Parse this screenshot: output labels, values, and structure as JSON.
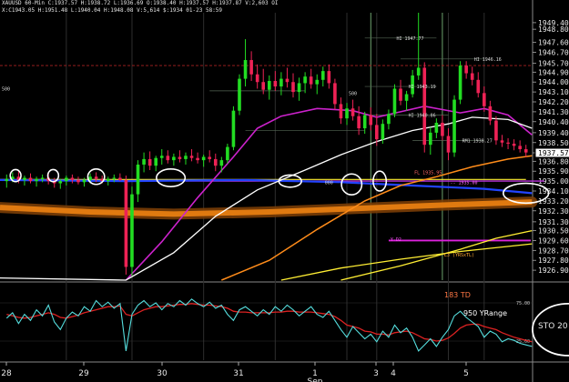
{
  "header": {
    "line1": "XAUUSD 60-Min  C:1937.57  H:1938.72  L:1936.69  O:1938.40  H:1937.57  H:1937.87  V:2,603  OI",
    "line2": "X:C1943.05  H:1951.48  L:1940.04  H:1948.08  V:5,614  $:1934  01-23  58:59"
  },
  "colors": {
    "up": "#22dd22",
    "down": "#ee2255",
    "bg": "#000000",
    "ma_fast": "#ffffff",
    "ma_mid": "#cc22cc",
    "ma_orange": "#ff8c1a",
    "ma_blue": "#2244ff",
    "ma_yellow": "#ffee33",
    "band_orange": "#e07a10",
    "osc_cyan": "#55dddd",
    "osc_red": "#dd2222",
    "ellipse": "#ffffff",
    "price_box": "#ffffff"
  },
  "chart_data": {
    "type": "candlestick",
    "ylim": [
      1926.0,
      1950.3
    ],
    "y_ticks": [
      "1949.40",
      "1948.80",
      "1947.60",
      "1946.70",
      "1945.70",
      "1944.90",
      "1944.00",
      "1943.10",
      "1942.20",
      "1941.30",
      "1940.40",
      "1939.40",
      "1938.50",
      "1937.57",
      "1936.80",
      "1935.90",
      "1935.00",
      "1934.10",
      "1933.20",
      "1932.30",
      "1931.30",
      "1930.50",
      "1929.60",
      "1928.70",
      "1927.80",
      "1926.90"
    ],
    "current_price": "1937.57",
    "x_ticks": [
      "28",
      "29",
      "30",
      "31",
      "1",
      "3",
      "4",
      "5"
    ],
    "x_sub_label": "Sep",
    "candles": [
      {
        "o": 1935.0,
        "h": 1935.6,
        "l": 1934.4,
        "c": 1935.2
      },
      {
        "o": 1935.2,
        "h": 1935.8,
        "l": 1934.9,
        "c": 1935.4
      },
      {
        "o": 1935.4,
        "h": 1935.9,
        "l": 1934.8,
        "c": 1935.1
      },
      {
        "o": 1935.1,
        "h": 1935.5,
        "l": 1934.6,
        "c": 1935.3
      },
      {
        "o": 1935.3,
        "h": 1935.7,
        "l": 1934.8,
        "c": 1935.0
      },
      {
        "o": 1935.0,
        "h": 1935.4,
        "l": 1934.5,
        "c": 1935.2
      },
      {
        "o": 1935.2,
        "h": 1935.6,
        "l": 1934.9,
        "c": 1935.3
      },
      {
        "o": 1935.3,
        "h": 1935.8,
        "l": 1934.7,
        "c": 1935.0
      },
      {
        "o": 1935.0,
        "h": 1935.3,
        "l": 1934.4,
        "c": 1934.8
      },
      {
        "o": 1934.8,
        "h": 1935.2,
        "l": 1934.3,
        "c": 1935.0
      },
      {
        "o": 1935.0,
        "h": 1935.5,
        "l": 1934.6,
        "c": 1935.3
      },
      {
        "o": 1935.3,
        "h": 1935.6,
        "l": 1934.8,
        "c": 1935.1
      },
      {
        "o": 1935.1,
        "h": 1935.4,
        "l": 1934.7,
        "c": 1934.9
      },
      {
        "o": 1934.9,
        "h": 1935.3,
        "l": 1934.5,
        "c": 1935.1
      },
      {
        "o": 1935.1,
        "h": 1935.7,
        "l": 1934.8,
        "c": 1935.4
      },
      {
        "o": 1935.4,
        "h": 1935.8,
        "l": 1934.9,
        "c": 1935.2
      },
      {
        "o": 1935.2,
        "h": 1935.5,
        "l": 1934.8,
        "c": 1935.0
      },
      {
        "o": 1935.0,
        "h": 1935.4,
        "l": 1934.6,
        "c": 1935.2
      },
      {
        "o": 1935.2,
        "h": 1935.6,
        "l": 1934.9,
        "c": 1935.3
      },
      {
        "o": 1935.3,
        "h": 1935.7,
        "l": 1935.0,
        "c": 1935.1
      },
      {
        "o": 1935.1,
        "h": 1935.5,
        "l": 1926.5,
        "c": 1927.2
      },
      {
        "o": 1927.2,
        "h": 1934.5,
        "l": 1926.4,
        "c": 1933.8
      },
      {
        "o": 1933.8,
        "h": 1936.9,
        "l": 1933.1,
        "c": 1936.5
      },
      {
        "o": 1936.5,
        "h": 1937.6,
        "l": 1935.8,
        "c": 1937.0
      },
      {
        "o": 1937.0,
        "h": 1937.7,
        "l": 1936.0,
        "c": 1936.4
      },
      {
        "o": 1936.4,
        "h": 1937.3,
        "l": 1935.9,
        "c": 1937.1
      },
      {
        "o": 1937.1,
        "h": 1937.9,
        "l": 1936.5,
        "c": 1937.3
      },
      {
        "o": 1937.3,
        "h": 1937.8,
        "l": 1936.6,
        "c": 1936.9
      },
      {
        "o": 1936.9,
        "h": 1937.5,
        "l": 1936.4,
        "c": 1937.2
      },
      {
        "o": 1937.2,
        "h": 1937.8,
        "l": 1936.7,
        "c": 1937.0
      },
      {
        "o": 1937.0,
        "h": 1937.6,
        "l": 1936.5,
        "c": 1937.3
      },
      {
        "o": 1937.3,
        "h": 1937.9,
        "l": 1936.8,
        "c": 1937.1
      },
      {
        "o": 1937.1,
        "h": 1937.6,
        "l": 1936.6,
        "c": 1936.9
      },
      {
        "o": 1936.9,
        "h": 1937.4,
        "l": 1936.3,
        "c": 1937.2
      },
      {
        "o": 1937.2,
        "h": 1937.8,
        "l": 1936.7,
        "c": 1937.0
      },
      {
        "o": 1937.0,
        "h": 1937.5,
        "l": 1935.9,
        "c": 1936.4
      },
      {
        "o": 1936.4,
        "h": 1937.2,
        "l": 1935.8,
        "c": 1936.9
      },
      {
        "o": 1936.9,
        "h": 1938.4,
        "l": 1936.6,
        "c": 1938.1
      },
      {
        "o": 1938.1,
        "h": 1941.8,
        "l": 1937.8,
        "c": 1941.4
      },
      {
        "o": 1941.4,
        "h": 1944.7,
        "l": 1941.0,
        "c": 1944.3
      },
      {
        "o": 1944.3,
        "h": 1947.9,
        "l": 1943.6,
        "c": 1946.0
      },
      {
        "o": 1946.0,
        "h": 1946.8,
        "l": 1944.1,
        "c": 1944.7
      },
      {
        "o": 1944.7,
        "h": 1945.6,
        "l": 1943.4,
        "c": 1944.0
      },
      {
        "o": 1944.0,
        "h": 1945.2,
        "l": 1942.9,
        "c": 1943.3
      },
      {
        "o": 1943.3,
        "h": 1944.6,
        "l": 1942.4,
        "c": 1944.1
      },
      {
        "o": 1944.1,
        "h": 1945.0,
        "l": 1943.2,
        "c": 1943.6
      },
      {
        "o": 1943.6,
        "h": 1944.9,
        "l": 1942.8,
        "c": 1944.3
      },
      {
        "o": 1944.3,
        "h": 1945.3,
        "l": 1943.5,
        "c": 1944.0
      },
      {
        "o": 1944.0,
        "h": 1944.8,
        "l": 1942.6,
        "c": 1943.1
      },
      {
        "o": 1943.1,
        "h": 1944.4,
        "l": 1942.3,
        "c": 1943.9
      },
      {
        "o": 1943.9,
        "h": 1944.9,
        "l": 1943.0,
        "c": 1944.5
      },
      {
        "o": 1944.5,
        "h": 1945.2,
        "l": 1943.4,
        "c": 1943.8
      },
      {
        "o": 1943.8,
        "h": 1944.7,
        "l": 1942.9,
        "c": 1944.2
      },
      {
        "o": 1944.2,
        "h": 1945.4,
        "l": 1943.6,
        "c": 1945.0
      },
      {
        "o": 1945.0,
        "h": 1945.6,
        "l": 1943.4,
        "c": 1943.9
      },
      {
        "o": 1943.9,
        "h": 1944.3,
        "l": 1941.5,
        "c": 1942.0
      },
      {
        "o": 1942.0,
        "h": 1942.6,
        "l": 1940.2,
        "c": 1940.7
      },
      {
        "o": 1940.7,
        "h": 1942.1,
        "l": 1940.1,
        "c": 1941.6
      },
      {
        "o": 1941.6,
        "h": 1942.4,
        "l": 1940.5,
        "c": 1940.9
      },
      {
        "o": 1940.9,
        "h": 1941.8,
        "l": 1939.2,
        "c": 1939.8
      },
      {
        "o": 1939.8,
        "h": 1941.3,
        "l": 1939.3,
        "c": 1941.0
      },
      {
        "o": 1941.0,
        "h": 1941.7,
        "l": 1939.6,
        "c": 1940.1
      },
      {
        "o": 1940.1,
        "h": 1941.1,
        "l": 1938.2,
        "c": 1938.8
      },
      {
        "o": 1938.8,
        "h": 1940.6,
        "l": 1938.4,
        "c": 1940.2
      },
      {
        "o": 1940.2,
        "h": 1941.5,
        "l": 1939.7,
        "c": 1941.1
      },
      {
        "o": 1941.1,
        "h": 1943.8,
        "l": 1940.8,
        "c": 1943.4
      },
      {
        "o": 1943.4,
        "h": 1944.2,
        "l": 1941.9,
        "c": 1942.3
      },
      {
        "o": 1942.3,
        "h": 1943.2,
        "l": 1941.4,
        "c": 1942.9
      },
      {
        "o": 1942.9,
        "h": 1945.1,
        "l": 1942.6,
        "c": 1944.6
      },
      {
        "o": 1944.6,
        "h": 1950.3,
        "l": 1944.2,
        "c": 1945.3
      },
      {
        "o": 1945.3,
        "h": 1945.8,
        "l": 1937.6,
        "c": 1938.3
      },
      {
        "o": 1938.3,
        "h": 1939.9,
        "l": 1937.4,
        "c": 1939.4
      },
      {
        "o": 1939.4,
        "h": 1940.7,
        "l": 1938.9,
        "c": 1940.3
      },
      {
        "o": 1940.3,
        "h": 1941.0,
        "l": 1938.7,
        "c": 1939.1
      },
      {
        "o": 1939.1,
        "h": 1939.8,
        "l": 1936.9,
        "c": 1937.6
      },
      {
        "o": 1937.6,
        "h": 1942.8,
        "l": 1937.2,
        "c": 1942.4
      },
      {
        "o": 1942.4,
        "h": 1945.9,
        "l": 1942.0,
        "c": 1945.5
      },
      {
        "o": 1945.5,
        "h": 1945.9,
        "l": 1944.3,
        "c": 1944.8
      },
      {
        "o": 1944.8,
        "h": 1945.4,
        "l": 1943.7,
        "c": 1944.2
      },
      {
        "o": 1944.2,
        "h": 1944.9,
        "l": 1942.6,
        "c": 1943.0
      },
      {
        "o": 1943.0,
        "h": 1943.6,
        "l": 1941.3,
        "c": 1941.8
      },
      {
        "o": 1941.8,
        "h": 1942.3,
        "l": 1940.1,
        "c": 1940.5
      },
      {
        "o": 1940.5,
        "h": 1940.9,
        "l": 1938.3,
        "c": 1938.7
      },
      {
        "o": 1938.7,
        "h": 1939.2,
        "l": 1938.1,
        "c": 1938.5
      },
      {
        "o": 1938.5,
        "h": 1938.9,
        "l": 1937.9,
        "c": 1938.4
      },
      {
        "o": 1938.4,
        "h": 1938.8,
        "l": 1937.8,
        "c": 1938.2
      },
      {
        "o": 1938.2,
        "h": 1938.7,
        "l": 1937.6,
        "c": 1937.9
      },
      {
        "o": 1937.9,
        "h": 1938.3,
        "l": 1937.2,
        "c": 1937.6
      }
    ],
    "ma_white": [
      [
        0,
        1926.2
      ],
      [
        20,
        1926.0
      ],
      [
        28,
        1928.5
      ],
      [
        35,
        1931.8
      ],
      [
        42,
        1934.2
      ],
      [
        50,
        1936.0
      ],
      [
        56,
        1937.4
      ],
      [
        62,
        1938.6
      ],
      [
        68,
        1939.6
      ],
      [
        74,
        1940.2
      ],
      [
        78,
        1940.8
      ],
      [
        84,
        1940.6
      ],
      [
        88,
        1939.8
      ]
    ],
    "ma_magenta": [
      [
        20,
        1926.0
      ],
      [
        26,
        1929.5
      ],
      [
        32,
        1933.5
      ],
      [
        38,
        1937.2
      ],
      [
        42,
        1939.8
      ],
      [
        46,
        1940.9
      ],
      [
        52,
        1941.6
      ],
      [
        58,
        1941.4
      ],
      [
        62,
        1940.8
      ],
      [
        66,
        1941.3
      ],
      [
        70,
        1941.8
      ],
      [
        76,
        1941.2
      ],
      [
        80,
        1941.6
      ],
      [
        84,
        1941.0
      ],
      [
        88,
        1939.2
      ]
    ],
    "ma_orange": [
      [
        36,
        1926.0
      ],
      [
        44,
        1927.8
      ],
      [
        52,
        1930.6
      ],
      [
        60,
        1933.2
      ],
      [
        66,
        1934.6
      ],
      [
        72,
        1935.4
      ],
      [
        78,
        1936.3
      ],
      [
        84,
        1937.0
      ],
      [
        88,
        1937.3
      ]
    ],
    "ma_blue": [
      [
        0,
        1935.1
      ],
      [
        20,
        1935.0
      ],
      [
        40,
        1935.1
      ],
      [
        56,
        1934.9
      ],
      [
        68,
        1934.6
      ],
      [
        80,
        1934.3
      ],
      [
        88,
        1933.9
      ]
    ],
    "band_orange": [
      [
        0,
        1932.6
      ],
      [
        14,
        1932.2
      ],
      [
        28,
        1932.0
      ],
      [
        44,
        1932.2
      ],
      [
        58,
        1932.5
      ],
      [
        72,
        1932.8
      ],
      [
        88,
        1933.1
      ]
    ],
    "ma_yellow": [
      [
        46,
        1926.0
      ],
      [
        56,
        1927.1
      ],
      [
        66,
        1927.9
      ],
      [
        76,
        1928.6
      ],
      [
        88,
        1929.3
      ]
    ],
    "ma_yellow2": [
      [
        56,
        1926.0
      ],
      [
        66,
        1927.3
      ],
      [
        76,
        1928.8
      ],
      [
        82,
        1929.8
      ],
      [
        88,
        1930.5
      ]
    ],
    "hline_yellow": 1935.15,
    "hline_magenta_mid": 1935.0,
    "hline_magenta_low": 1929.6,
    "red_dash_level": 1945.5,
    "labels": [
      {
        "text": "HI 1947.77",
        "x": 65,
        "y": 1948.0
      },
      {
        "text": "HI 1946.16",
        "x": 78,
        "y": 1946.1
      },
      {
        "text": "HI 1943.19",
        "x": 67,
        "y": 1943.6
      },
      {
        "text": "HI 1940.86",
        "x": 67,
        "y": 1941.0
      },
      {
        "text": "RM1 1938.27",
        "x": 76,
        "y": 1938.7
      },
      {
        "text": "FL 1935.95",
        "x": 68,
        "y": 1935.8
      },
      {
        "text": "-- 1935.00",
        "x": 74,
        "y": 1934.9
      },
      {
        "text": "Y-D2",
        "x": 64,
        "y": 1929.7
      },
      {
        "text": "L3 (YRSxTL)",
        "x": 73,
        "y": 1928.3
      },
      {
        "text": "500",
        "x": 1,
        "y": 1943.4
      },
      {
        "text": "500",
        "x": 57,
        "y": 1943.0
      },
      {
        "text": "000",
        "x": 53,
        "y": 1934.9
      }
    ],
    "ellipses": [
      {
        "x": 1.5,
        "y": 1935.5,
        "rx": 0.9,
        "ry": 0.55
      },
      {
        "x": 7.8,
        "y": 1935.5,
        "rx": 0.9,
        "ry": 0.55
      },
      {
        "x": 15.0,
        "y": 1935.4,
        "rx": 1.4,
        "ry": 0.7
      },
      {
        "x": 27.5,
        "y": 1935.3,
        "rx": 2.4,
        "ry": 0.8
      },
      {
        "x": 47.5,
        "y": 1935.0,
        "rx": 1.9,
        "ry": 0.55
      },
      {
        "x": 57.8,
        "y": 1934.7,
        "rx": 1.7,
        "ry": 0.95
      },
      {
        "x": 62.5,
        "y": 1935.0,
        "rx": 1.1,
        "ry": 0.9
      },
      {
        "x": 87.0,
        "y": 1933.9,
        "rx": 3.8,
        "ry": 0.9
      }
    ],
    "oscillator": {
      "ylim": [
        0,
        100
      ],
      "y_ticks": [
        "75.00",
        "25.00"
      ],
      "label": "183 TD",
      "label2": "950 YRange",
      "side_label": "STO  20",
      "fast": [
        55,
        62,
        48,
        60,
        52,
        66,
        58,
        72,
        50,
        40,
        55,
        63,
        58,
        70,
        64,
        78,
        70,
        76,
        68,
        74,
        12,
        60,
        72,
        78,
        70,
        75,
        66,
        74,
        70,
        78,
        72,
        80,
        74,
        70,
        76,
        68,
        72,
        60,
        52,
        66,
        70,
        64,
        58,
        66,
        60,
        70,
        64,
        72,
        66,
        58,
        64,
        70,
        60,
        56,
        64,
        52,
        40,
        30,
        44,
        36,
        28,
        34,
        24,
        38,
        30,
        46,
        36,
        42,
        30,
        12,
        20,
        28,
        18,
        30,
        40,
        58,
        64,
        56,
        50,
        44,
        30,
        38,
        34,
        24,
        28,
        26,
        22,
        20,
        18
      ],
      "slow": [
        60,
        58,
        56,
        55,
        56,
        58,
        60,
        62,
        60,
        56,
        55,
        57,
        59,
        62,
        64,
        66,
        68,
        70,
        70,
        71,
        60,
        58,
        62,
        66,
        68,
        70,
        70,
        71,
        72,
        73,
        73,
        74,
        73,
        72,
        72,
        71,
        70,
        68,
        64,
        63,
        63,
        62,
        62,
        62,
        62,
        63,
        63,
        64,
        64,
        63,
        63,
        63,
        62,
        61,
        60,
        57,
        52,
        46,
        44,
        42,
        38,
        37,
        34,
        34,
        33,
        36,
        37,
        38,
        36,
        32,
        28,
        27,
        25,
        26,
        29,
        35,
        42,
        46,
        47,
        47,
        44,
        42,
        40,
        36,
        33,
        30,
        28,
        26,
        24
      ],
      "circle": {
        "x": 88.0,
        "y": 40,
        "rx": 6.0,
        "ry": 34
      }
    }
  }
}
